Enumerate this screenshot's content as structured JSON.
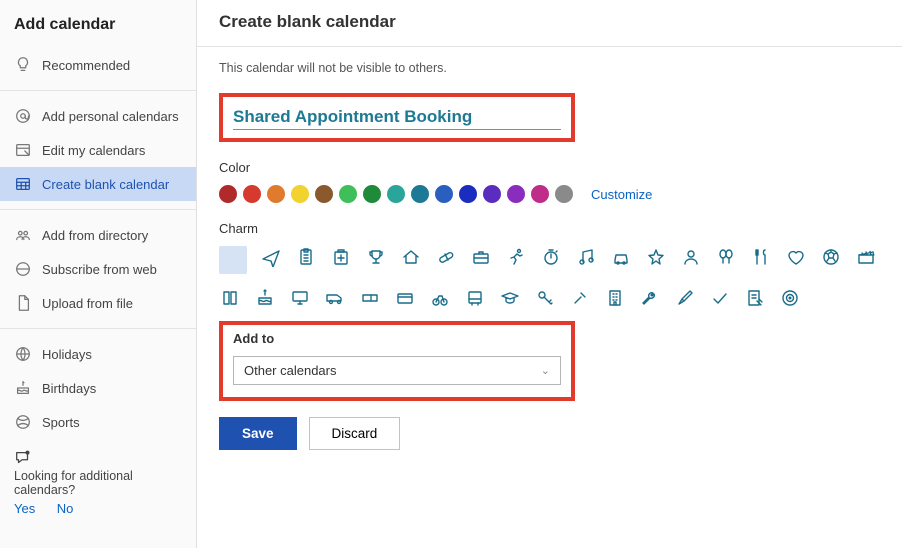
{
  "sidebar": {
    "title": "Add calendar",
    "items": [
      {
        "label": "Recommended",
        "icon": "lightbulb"
      },
      {
        "label": "Add personal calendars",
        "icon": "at"
      },
      {
        "label": "Edit my calendars",
        "icon": "edit-calendar"
      },
      {
        "label": "Create blank calendar",
        "icon": "grid-calendar",
        "selected": true
      },
      {
        "label": "Add from directory",
        "icon": "directory"
      },
      {
        "label": "Subscribe from web",
        "icon": "web"
      },
      {
        "label": "Upload from file",
        "icon": "file"
      },
      {
        "label": "Holidays",
        "icon": "globe"
      },
      {
        "label": "Birthdays",
        "icon": "cake"
      },
      {
        "label": "Sports",
        "icon": "sports"
      }
    ],
    "footer": {
      "prompt": "Looking for additional calendars?",
      "yes": "Yes",
      "no": "No"
    }
  },
  "main": {
    "title": "Create blank calendar",
    "note": "This calendar will not be visible to others.",
    "calendar_name": "Shared Appointment Booking",
    "color_label": "Color",
    "colors": [
      "#b02a2a",
      "#d63a2e",
      "#e07a2d",
      "#f2d22e",
      "#8a5a2e",
      "#3fbf5a",
      "#1e8a3a",
      "#2aa59a",
      "#1e7a94",
      "#2a5fbf",
      "#1a2dbf",
      "#5a2dbf",
      "#8a2dbf",
      "#bf2d8a",
      "#8a8a8a"
    ],
    "customize": "Customize",
    "charm_label": "Charm",
    "charms": [
      "blank",
      "plane",
      "clipboard",
      "medical",
      "trophy",
      "home",
      "pill",
      "briefcase",
      "running",
      "stopwatch",
      "music",
      "car",
      "star",
      "person",
      "balloons",
      "food",
      "heart",
      "soccer",
      "clapper",
      "book",
      "cake",
      "monitor",
      "van",
      "ticket",
      "credit-card",
      "bicycle",
      "bus",
      "graduation",
      "key",
      "repair",
      "building",
      "wrench",
      "paintbrush",
      "check",
      "note-edit",
      "target"
    ],
    "addto_label": "Add to",
    "addto_value": "Other calendars",
    "save": "Save",
    "discard": "Discard"
  }
}
